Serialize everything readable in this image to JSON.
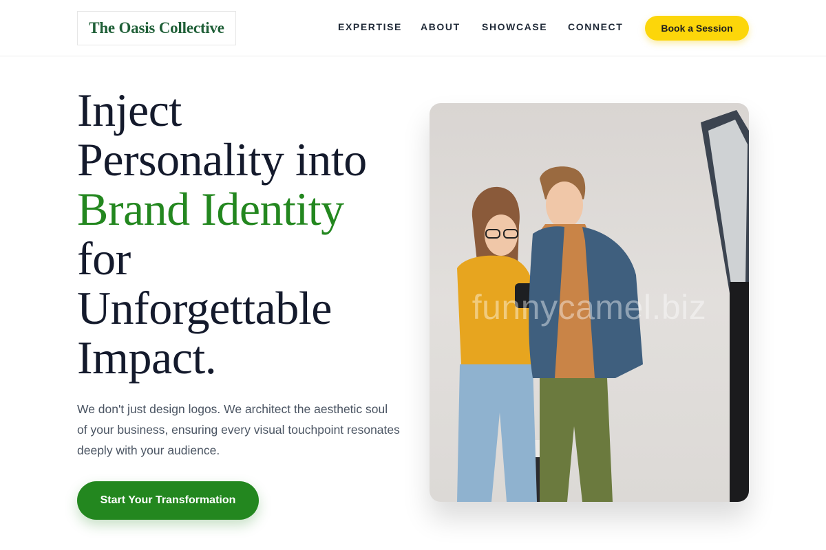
{
  "header": {
    "logo": "The Oasis Collective",
    "nav": [
      "EXPERTISE",
      "ABOUT",
      "SHOWCASE",
      "CONNECT"
    ],
    "cta": "Book a Session"
  },
  "hero": {
    "title_lines": [
      "Inject",
      "Personality into",
      "Brand Identity",
      "for",
      "Unforgettable",
      "Impact."
    ],
    "subtitle": "We don't just design logos. We architect the aesthetic soul of your business, ensuring every visual touchpoint resonates deeply with your audience.",
    "cta": "Start Your Transformation",
    "image_watermark": "funnycamel.biz"
  },
  "colors": {
    "brand_green": "#23871f",
    "logo_green": "#1f5f37",
    "accent_yellow": "#fcd60a",
    "heading_dark": "#141a2c",
    "body_gray": "#4b5563"
  }
}
